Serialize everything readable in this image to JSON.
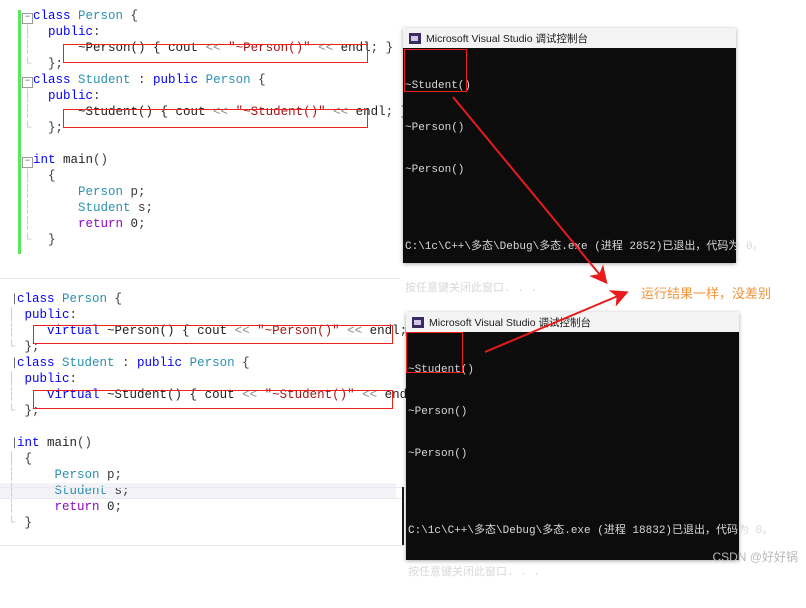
{
  "editors": [
    {
      "id": "editor-top",
      "lines": [
        {
          "glyph": "minus",
          "segments": [
            {
              "t": "class ",
              "c": "kw"
            },
            {
              "t": "Person",
              "c": "type"
            },
            {
              "t": " {",
              "c": "pun"
            }
          ]
        },
        {
          "glyph": "pipe",
          "segments": [
            {
              "t": "  ",
              "c": "plain"
            },
            {
              "t": "public",
              "c": "kw"
            },
            {
              "t": ":",
              "c": "pun"
            }
          ]
        },
        {
          "glyph": "dots",
          "segments": [
            {
              "t": "      ~Person() { ",
              "c": "plain"
            },
            {
              "t": "cout",
              "c": "plain"
            },
            {
              "t": " << ",
              "c": "op"
            },
            {
              "t": "\"~Person()\"",
              "c": "str"
            },
            {
              "t": " << ",
              "c": "op"
            },
            {
              "t": "endl",
              "c": "plain"
            },
            {
              "t": "; }",
              "c": "pun"
            }
          ]
        },
        {
          "glyph": "end",
          "segments": [
            {
              "t": "  };",
              "c": "pun"
            }
          ]
        },
        {
          "glyph": "minus",
          "segments": [
            {
              "t": "class ",
              "c": "kw"
            },
            {
              "t": "Student",
              "c": "type"
            },
            {
              "t": " : ",
              "c": "pun"
            },
            {
              "t": "public ",
              "c": "kw"
            },
            {
              "t": "Person",
              "c": "type"
            },
            {
              "t": " {",
              "c": "pun"
            }
          ]
        },
        {
          "glyph": "pipe",
          "segments": [
            {
              "t": "  ",
              "c": "plain"
            },
            {
              "t": "public",
              "c": "kw"
            },
            {
              "t": ":",
              "c": "pun"
            }
          ]
        },
        {
          "glyph": "dots",
          "segments": [
            {
              "t": "      ~Student() { ",
              "c": "plain"
            },
            {
              "t": "cout",
              "c": "plain"
            },
            {
              "t": " << ",
              "c": "op"
            },
            {
              "t": "\"~Student()\"",
              "c": "str"
            },
            {
              "t": " << ",
              "c": "op"
            },
            {
              "t": "endl",
              "c": "plain"
            },
            {
              "t": "; }",
              "c": "pun"
            }
          ]
        },
        {
          "glyph": "end",
          "segments": [
            {
              "t": "  };",
              "c": "pun"
            }
          ]
        },
        {
          "glyph": "none",
          "segments": [
            {
              "t": "",
              "c": "plain"
            }
          ]
        },
        {
          "glyph": "minus",
          "segments": [
            {
              "t": "int ",
              "c": "kw"
            },
            {
              "t": "main",
              "c": "plain"
            },
            {
              "t": "()",
              "c": "pun"
            }
          ]
        },
        {
          "glyph": "pipe",
          "segments": [
            {
              "t": "  {",
              "c": "pun"
            }
          ]
        },
        {
          "glyph": "dots",
          "segments": [
            {
              "t": "      ",
              "c": "plain"
            },
            {
              "t": "Person",
              "c": "type"
            },
            {
              "t": " p;",
              "c": "pun"
            }
          ]
        },
        {
          "glyph": "dots",
          "segments": [
            {
              "t": "      ",
              "c": "plain"
            },
            {
              "t": "Student",
              "c": "type"
            },
            {
              "t": " s;",
              "c": "pun"
            }
          ]
        },
        {
          "glyph": "dots",
          "segments": [
            {
              "t": "      ",
              "c": "plain"
            },
            {
              "t": "return",
              "c": "ctrl"
            },
            {
              "t": " ",
              "c": "plain"
            },
            {
              "t": "0",
              "c": "num"
            },
            {
              "t": ";",
              "c": "pun"
            }
          ]
        },
        {
          "glyph": "end",
          "segments": [
            {
              "t": "  }",
              "c": "pun"
            }
          ]
        }
      ]
    },
    {
      "id": "editor-bottom",
      "lines": [
        {
          "glyph": "minus2",
          "segments": [
            {
              "t": "class ",
              "c": "kw"
            },
            {
              "t": "Person",
              "c": "type"
            },
            {
              "t": " {",
              "c": "pun"
            }
          ]
        },
        {
          "glyph": "pipe",
          "segments": [
            {
              "t": " ",
              "c": "plain"
            },
            {
              "t": "public",
              "c": "kw"
            },
            {
              "t": ":",
              "c": "pun"
            }
          ]
        },
        {
          "glyph": "dots",
          "segments": [
            {
              "t": "    ",
              "c": "plain"
            },
            {
              "t": "virtual",
              "c": "kw"
            },
            {
              "t": " ~Person() { ",
              "c": "plain"
            },
            {
              "t": "cout",
              "c": "plain"
            },
            {
              "t": " << ",
              "c": "op"
            },
            {
              "t": "\"~Person()\"",
              "c": "str"
            },
            {
              "t": " << ",
              "c": "op"
            },
            {
              "t": "endl",
              "c": "plain"
            },
            {
              "t": "; }",
              "c": "pun"
            }
          ]
        },
        {
          "glyph": "end",
          "segments": [
            {
              "t": " };",
              "c": "pun"
            }
          ]
        },
        {
          "glyph": "minus2",
          "segments": [
            {
              "t": "class ",
              "c": "kw"
            },
            {
              "t": "Student",
              "c": "type"
            },
            {
              "t": " : ",
              "c": "pun"
            },
            {
              "t": "public ",
              "c": "kw"
            },
            {
              "t": "Person",
              "c": "type"
            },
            {
              "t": " {",
              "c": "pun"
            }
          ]
        },
        {
          "glyph": "pipe",
          "segments": [
            {
              "t": " ",
              "c": "plain"
            },
            {
              "t": "public",
              "c": "kw"
            },
            {
              "t": ":",
              "c": "pun"
            }
          ]
        },
        {
          "glyph": "dots",
          "segments": [
            {
              "t": "    ",
              "c": "plain"
            },
            {
              "t": "virtual",
              "c": "kw"
            },
            {
              "t": " ~Student() { ",
              "c": "plain"
            },
            {
              "t": "cout",
              "c": "plain"
            },
            {
              "t": " << ",
              "c": "op"
            },
            {
              "t": "\"~Student()\"",
              "c": "str"
            },
            {
              "t": " << ",
              "c": "op"
            },
            {
              "t": "endl",
              "c": "plain"
            },
            {
              "t": "; }",
              "c": "pun"
            }
          ]
        },
        {
          "glyph": "end",
          "segments": [
            {
              "t": " };",
              "c": "pun"
            }
          ]
        },
        {
          "glyph": "none",
          "segments": [
            {
              "t": "",
              "c": "plain"
            }
          ]
        },
        {
          "glyph": "minus2",
          "segments": [
            {
              "t": "int ",
              "c": "kw"
            },
            {
              "t": "main",
              "c": "plain"
            },
            {
              "t": "()",
              "c": "pun"
            }
          ]
        },
        {
          "glyph": "pipe",
          "segments": [
            {
              "t": " {",
              "c": "pun"
            }
          ]
        },
        {
          "glyph": "dots",
          "segments": [
            {
              "t": "     ",
              "c": "plain"
            },
            {
              "t": "Person",
              "c": "type"
            },
            {
              "t": " p;",
              "c": "pun"
            }
          ]
        },
        {
          "glyph": "dots",
          "hl": true,
          "segments": [
            {
              "t": "     ",
              "c": "plain"
            },
            {
              "t": "Student",
              "c": "type"
            },
            {
              "t": " s;",
              "c": "pun"
            }
          ]
        },
        {
          "glyph": "dots",
          "segments": [
            {
              "t": "     ",
              "c": "plain"
            },
            {
              "t": "return",
              "c": "ctrl"
            },
            {
              "t": " ",
              "c": "plain"
            },
            {
              "t": "0",
              "c": "num"
            },
            {
              "t": ";",
              "c": "pun"
            }
          ]
        },
        {
          "glyph": "end",
          "segments": [
            {
              "t": " }",
              "c": "pun"
            }
          ]
        }
      ]
    }
  ],
  "consoles": [
    {
      "id": "console-top",
      "title": "Microsoft Visual Studio 调试控制台",
      "output": [
        "~Student()",
        "~Person()",
        "~Person()"
      ],
      "exit_line": "C:\\1c\\C++\\多态\\Debug\\多态.exe (进程 2852)已退出，代码为 0。",
      "prompt_line": "按任意键关闭此窗口. . ."
    },
    {
      "id": "console-bottom",
      "title": "Microsoft Visual Studio 调试控制台",
      "output": [
        "~Student()",
        "~Person()",
        "~Person()"
      ],
      "exit_line": "C:\\1c\\C++\\多态\\Debug\\多态.exe (进程 18832)已退出，代码为 0。",
      "prompt_line": "按任意键关闭此窗口. . ."
    }
  ],
  "annotation": {
    "text": "运行结果一样，没差别",
    "color": "#f29338"
  },
  "watermark": {
    "text": "CSDN @好好锅"
  },
  "colors": {
    "highlight_box": "#ef2020",
    "arrow": "#e81a1a",
    "change_bar": "#5ce65c",
    "console_bg": "#0c0c0c",
    "keyword": "#0000ff",
    "type": "#2b91af",
    "string": "#a31515",
    "control": "#8f08c4"
  }
}
